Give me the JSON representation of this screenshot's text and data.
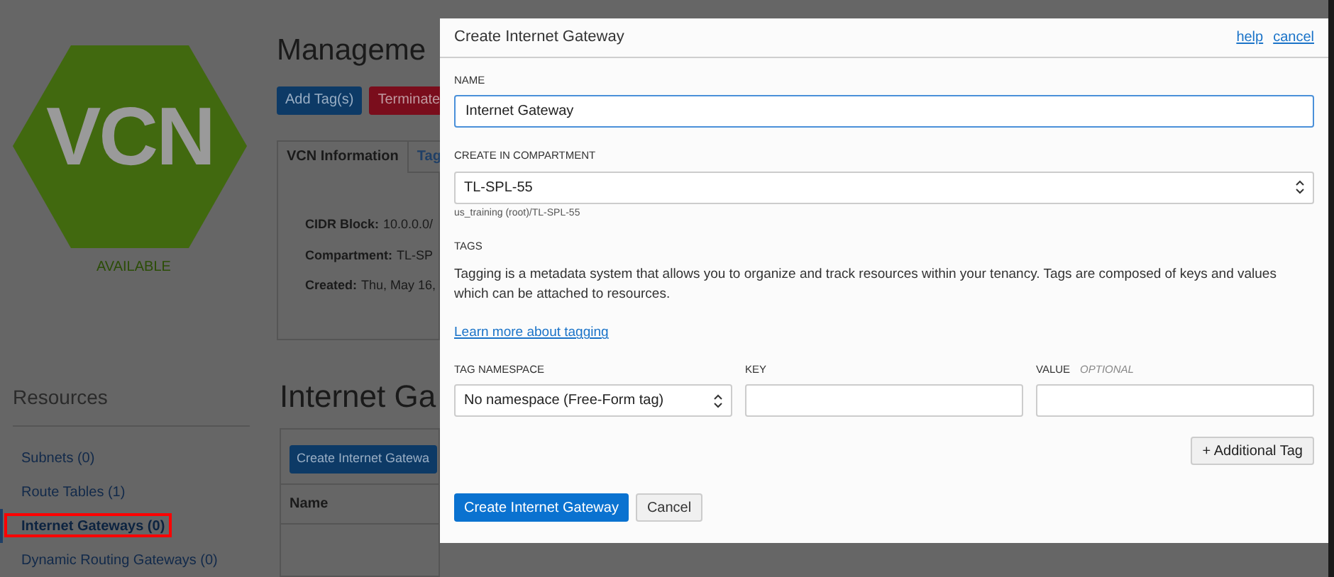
{
  "page": {
    "logo_text": "VCN",
    "status": "AVAILABLE",
    "title": "Manageme",
    "buttons": [
      {
        "label": "Add Tag(s)",
        "kind": "primary"
      },
      {
        "label": "Terminate",
        "kind": "danger"
      }
    ],
    "tabs": [
      {
        "label": "VCN Information",
        "selected": true
      },
      {
        "label": "Tag",
        "selected": false
      }
    ],
    "details": [
      {
        "label": "CIDR Block:",
        "value": "10.0.0.0/"
      },
      {
        "label": "Compartment:",
        "value": "TL-SP"
      },
      {
        "label": "Created:",
        "value": "Thu, May 16,"
      }
    ],
    "resources": {
      "title": "Resources",
      "items": [
        {
          "label": "Subnets (0)",
          "selected": false,
          "highlighted": false
        },
        {
          "label": "Route Tables (1)",
          "selected": false,
          "highlighted": false
        },
        {
          "label": "Internet Gateways (0)",
          "selected": true,
          "highlighted": true
        },
        {
          "label": "Dynamic Routing Gateways (0)",
          "selected": false,
          "highlighted": false
        }
      ]
    },
    "section_title": "Internet Ga",
    "create_button": "Create Internet Gatewa",
    "table": {
      "columns": [
        "Name"
      ]
    }
  },
  "dialog": {
    "title": "Create Internet Gateway",
    "links": [
      "help",
      "cancel"
    ],
    "name": {
      "label": "NAME",
      "value": "Internet Gateway"
    },
    "compartment": {
      "label": "CREATE IN COMPARTMENT",
      "value": "TL-SPL-55",
      "hint": "us_training (root)/TL-SPL-55"
    },
    "tags": {
      "title": "TAGS",
      "description": "Tagging is a metadata system that allows you to organize and track resources within your tenancy. Tags are composed of keys and values which can be attached to resources.",
      "link": "Learn more about tagging",
      "columns": [
        {
          "label": "TAG NAMESPACE"
        },
        {
          "label": "KEY"
        },
        {
          "label": "VALUE",
          "note": "OPTIONAL"
        }
      ],
      "namespace": "No namespace (Free-Form tag)",
      "add_button": "+ Additional Tag"
    },
    "buttons": [
      {
        "label": "Create Internet Gateway",
        "kind": "primary"
      },
      {
        "label": "Cancel",
        "kind": "secondary"
      }
    ]
  }
}
